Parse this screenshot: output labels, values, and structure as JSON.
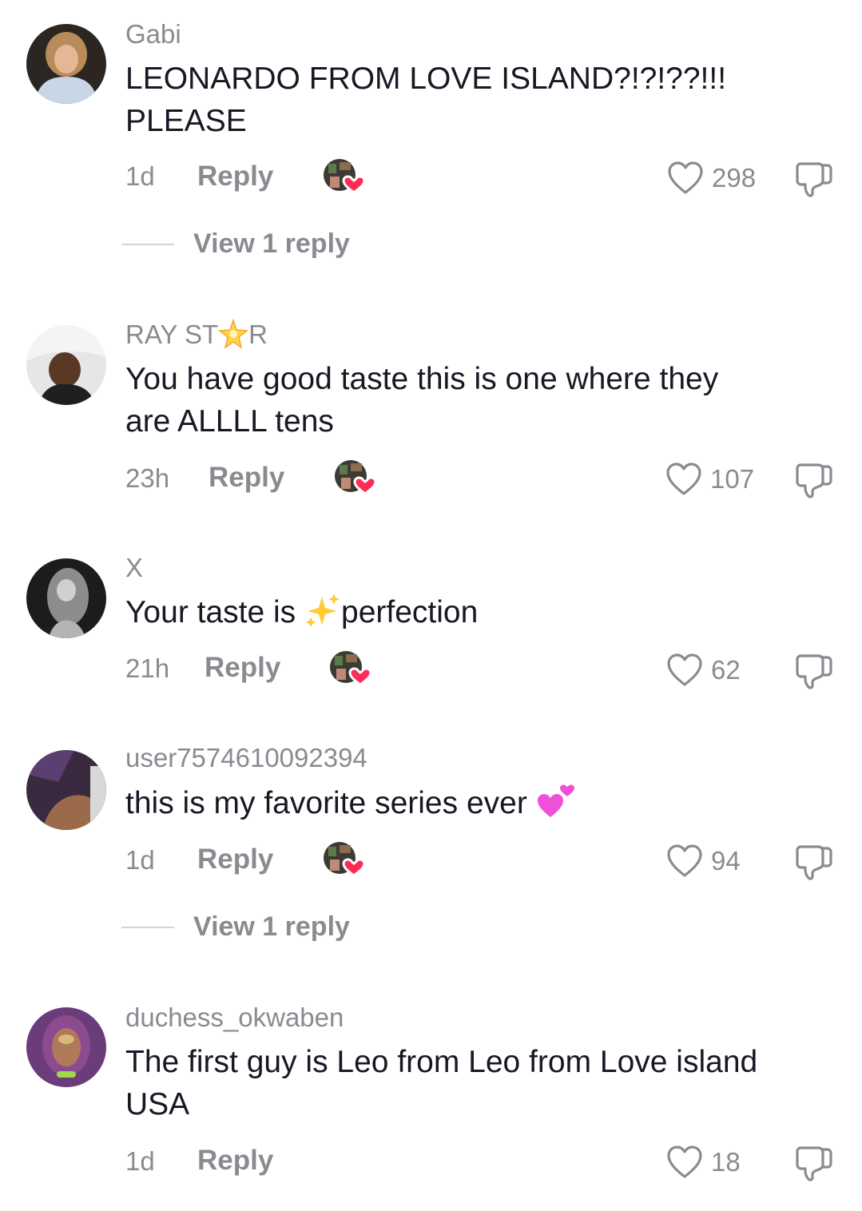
{
  "comments": [
    {
      "username": "Gabi",
      "text_lines": [
        "LEONARDO FROM LOVE ISLAND?!?!??!!!",
        "PLEASE"
      ],
      "time": "1d",
      "reply_label": "Reply",
      "creator_liked": true,
      "likes": "298",
      "view_replies": "View 1 reply",
      "avatar": "avatar-gabi"
    },
    {
      "username_parts": [
        "RAY ST",
        "R"
      ],
      "username_emoji": "glowing-star",
      "text_lines": [
        "You have good taste this is one where they",
        "are ALLLL tens"
      ],
      "time": "23h",
      "reply_label": "Reply",
      "creator_liked": true,
      "likes": "107",
      "avatar": "avatar-ray"
    },
    {
      "username": "X",
      "text_parts": [
        "Your taste is ",
        "perfection"
      ],
      "text_emoji": "sparkles",
      "time": "21h",
      "reply_label": "Reply",
      "creator_liked": true,
      "likes": "62",
      "avatar": "avatar-x"
    },
    {
      "username": "user7574610092394",
      "text_parts": [
        "this is my favorite series ever "
      ],
      "text_emoji": "two-hearts",
      "time": "1d",
      "reply_label": "Reply",
      "creator_liked": true,
      "likes": "94",
      "view_replies": "View 1 reply",
      "avatar": "avatar-user"
    },
    {
      "username": "duchess_okwaben",
      "text_lines": [
        "The first guy is Leo from Leo from Love island",
        "USA"
      ],
      "time": "1d",
      "reply_label": "Reply",
      "creator_liked": false,
      "likes": "18",
      "avatar": "avatar-duchess"
    }
  ],
  "icons": {
    "like": "heart-outline-icon",
    "dislike": "thumbs-down-icon",
    "creator_like": "creator-heart-icon"
  },
  "colors": {
    "text": "#161823",
    "muted": "#8a8b91",
    "heart": "#fe2c55"
  }
}
